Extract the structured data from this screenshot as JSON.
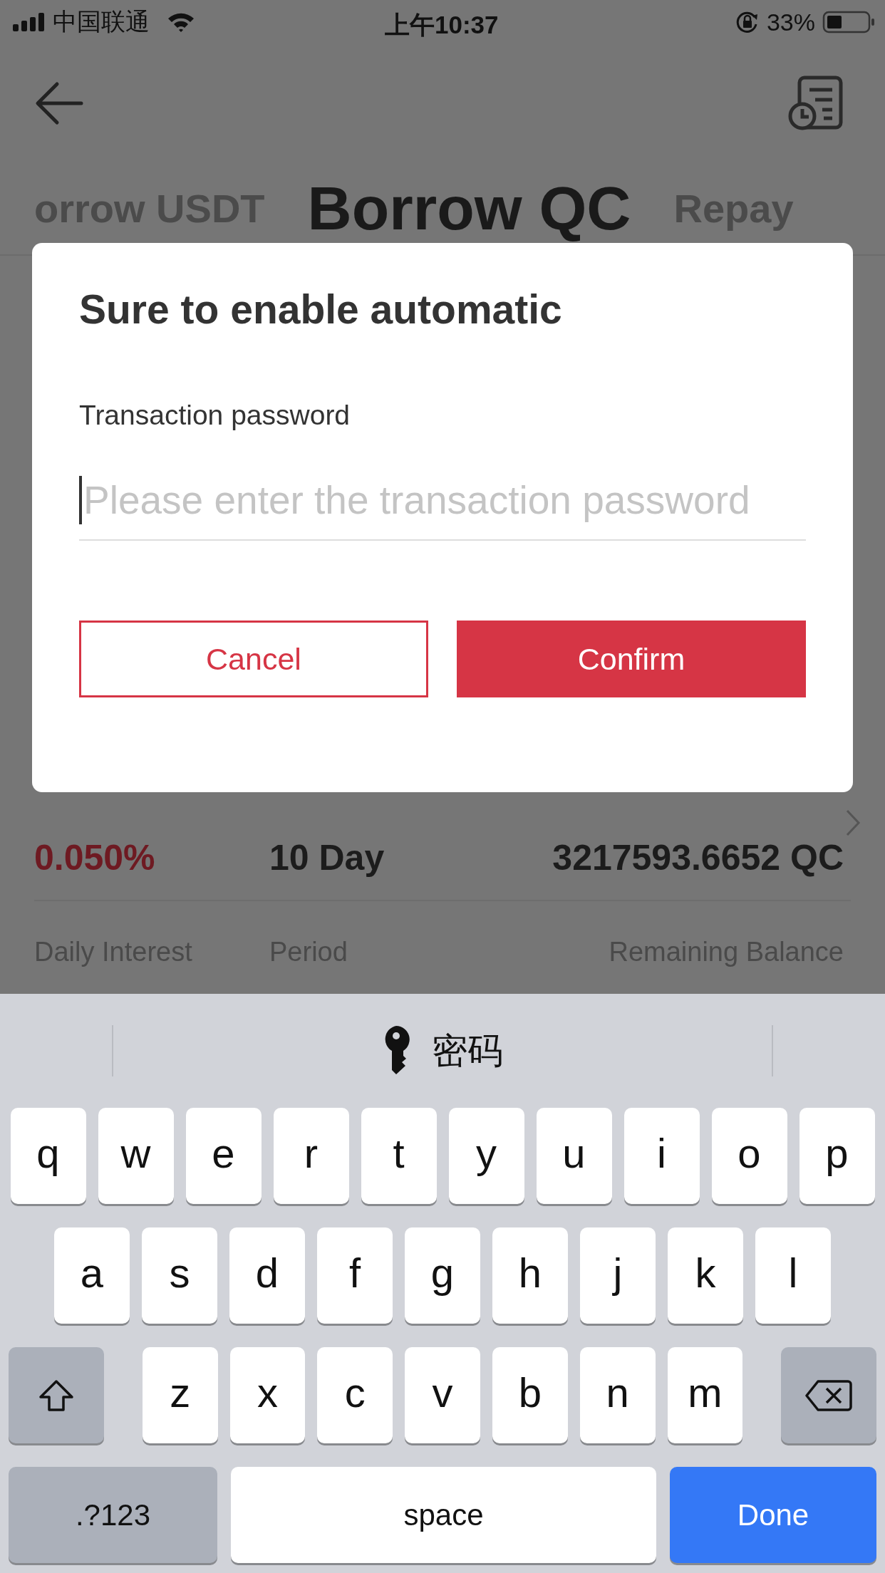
{
  "status_bar": {
    "carrier": "中国联通",
    "time": "上午10:37",
    "battery": "33%"
  },
  "tabs": [
    {
      "label": "orrow USDT",
      "selected": false
    },
    {
      "label": "Borrow QC",
      "selected": true
    },
    {
      "label": "Repay",
      "selected": false
    }
  ],
  "records": [
    {
      "kind": "values",
      "cells": [
        "0.050%",
        "10 Day",
        "3217593.6652 QC"
      ]
    },
    {
      "kind": "labels",
      "cells": [
        "Daily Interest",
        "Period",
        "Remaining Balance"
      ]
    }
  ],
  "dialog": {
    "title": "Sure to enable automatic",
    "field_label": "Transaction password",
    "placeholder": "Please enter the transaction password",
    "buttons": [
      {
        "label": "Cancel",
        "kind": "secondary"
      },
      {
        "label": "Confirm",
        "kind": "primary"
      }
    ]
  },
  "keyboard": {
    "suggestion": "密码",
    "rows": [
      {
        "keys": [
          {
            "kind": "letter",
            "label": "q"
          },
          {
            "kind": "letter",
            "label": "w"
          },
          {
            "kind": "letter",
            "label": "e"
          },
          {
            "kind": "letter",
            "label": "r"
          },
          {
            "kind": "letter",
            "label": "t"
          },
          {
            "kind": "letter",
            "label": "y"
          },
          {
            "kind": "letter",
            "label": "u"
          },
          {
            "kind": "letter",
            "label": "i"
          },
          {
            "kind": "letter",
            "label": "o"
          },
          {
            "kind": "letter",
            "label": "p"
          }
        ]
      },
      {
        "keys": [
          {
            "kind": "letter",
            "label": "a"
          },
          {
            "kind": "letter",
            "label": "s"
          },
          {
            "kind": "letter",
            "label": "d"
          },
          {
            "kind": "letter",
            "label": "f"
          },
          {
            "kind": "letter",
            "label": "g"
          },
          {
            "kind": "letter",
            "label": "h"
          },
          {
            "kind": "letter",
            "label": "j"
          },
          {
            "kind": "letter",
            "label": "k"
          },
          {
            "kind": "letter",
            "label": "l"
          }
        ]
      },
      {
        "keys": [
          {
            "kind": "shift"
          },
          {
            "kind": "letter",
            "label": "z"
          },
          {
            "kind": "letter",
            "label": "x"
          },
          {
            "kind": "letter",
            "label": "c"
          },
          {
            "kind": "letter",
            "label": "v"
          },
          {
            "kind": "letter",
            "label": "b"
          },
          {
            "kind": "letter",
            "label": "n"
          },
          {
            "kind": "letter",
            "label": "m"
          },
          {
            "kind": "delete"
          }
        ]
      },
      {
        "keys": [
          {
            "kind": "mode",
            "label": ".?123"
          },
          {
            "kind": "space",
            "label": "space"
          },
          {
            "kind": "done",
            "label": "Done"
          }
        ]
      }
    ]
  }
}
